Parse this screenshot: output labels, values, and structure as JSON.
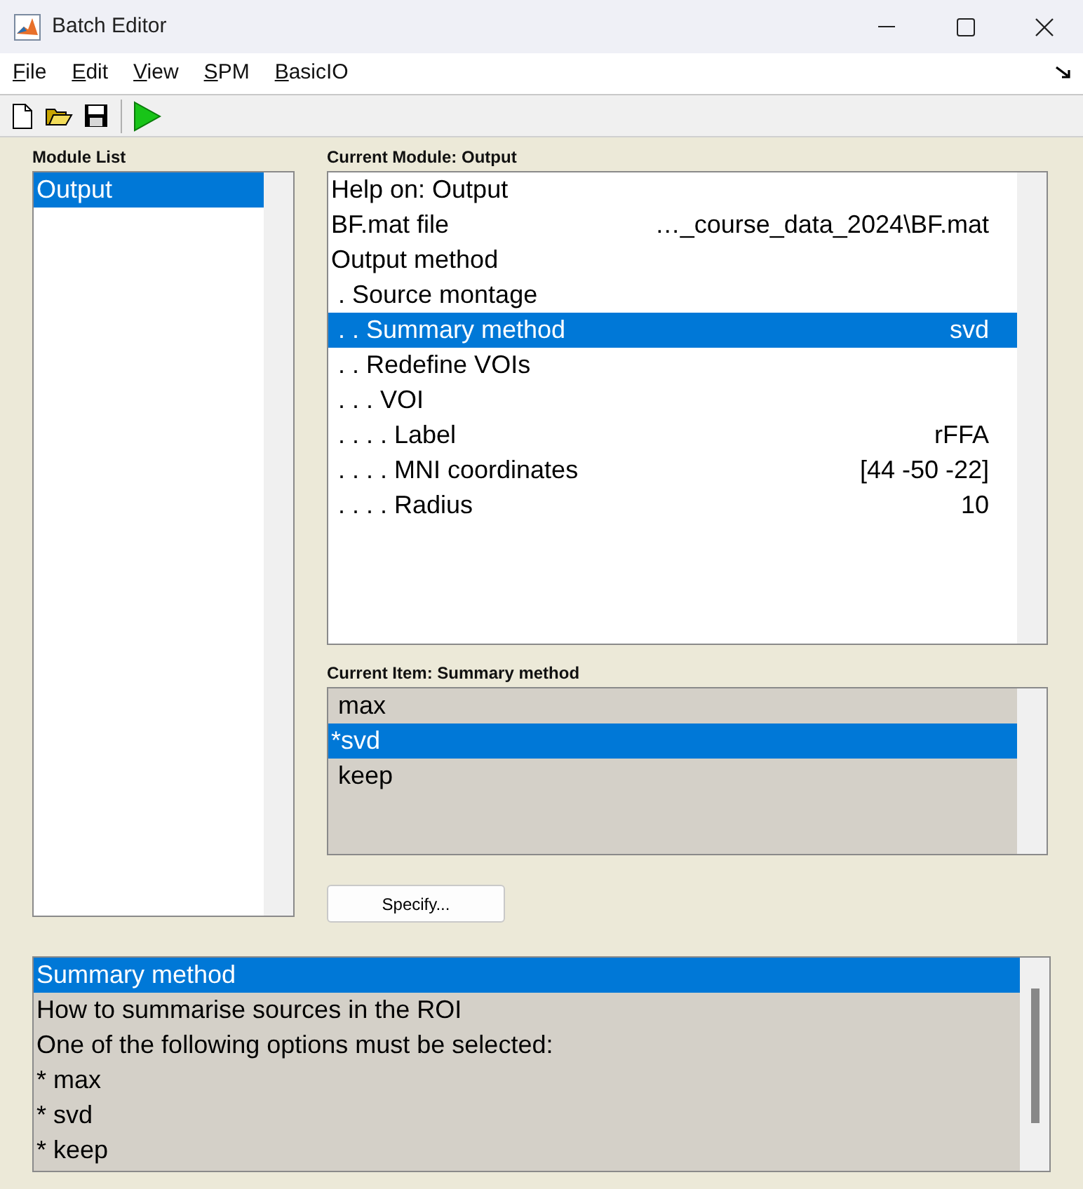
{
  "window": {
    "title": "Batch Editor"
  },
  "menu": [
    "File",
    "Edit",
    "View",
    "SPM",
    "BasicIO"
  ],
  "module_list": {
    "label": "Module List",
    "items": [
      {
        "text": "Output",
        "selected": true
      }
    ]
  },
  "current_module": {
    "label": "Current Module: Output",
    "items": [
      {
        "text": "Help on: Output",
        "selected": false
      },
      {
        "text": "BF.mat file",
        "value": "…_course_data_2024\\BF.mat",
        "selected": false
      },
      {
        "text": "Output method",
        "selected": false
      },
      {
        "text": " . Source montage",
        "selected": false
      },
      {
        "text": " . . Summary method",
        "value": "svd",
        "selected": true
      },
      {
        "text": " . . Redefine VOIs",
        "selected": false
      },
      {
        "text": " . . . VOI",
        "selected": false
      },
      {
        "text": " . . . . Label",
        "value": "rFFA",
        "selected": false
      },
      {
        "text": " . . . . MNI coordinates",
        "value": "[44 -50 -22]",
        "selected": false
      },
      {
        "text": " . . . . Radius",
        "value": "10",
        "selected": false
      }
    ]
  },
  "current_item": {
    "label": "Current Item: Summary method",
    "options": [
      {
        "text": " max",
        "selected": false
      },
      {
        "text": "*svd",
        "selected": true
      },
      {
        "text": " keep",
        "selected": false
      }
    ]
  },
  "specify_button": "Specify...",
  "help": {
    "lines": [
      {
        "text": "Summary method",
        "selected": true
      },
      {
        "text": "How to summarise sources in the ROI",
        "selected": false
      },
      {
        "text": "One of the following options must be selected:",
        "selected": false
      },
      {
        "text": "* max",
        "selected": false
      },
      {
        "text": "* svd",
        "selected": false
      },
      {
        "text": "* keep",
        "selected": false
      }
    ]
  }
}
